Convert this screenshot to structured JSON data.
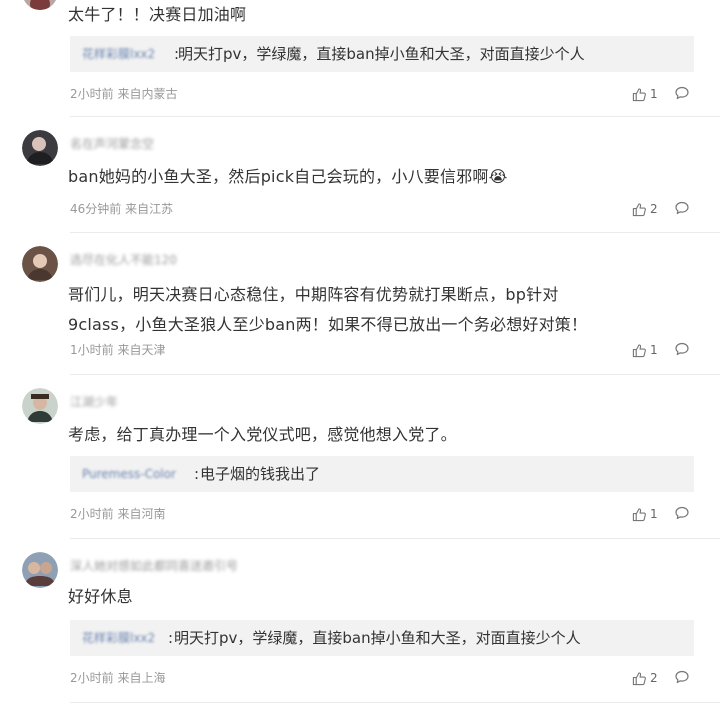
{
  "comments": [
    {
      "username": "",
      "text": "太牛了！！决赛日加油啊",
      "reply": {
        "user": "花样彩膜lxx2",
        "colon": ":",
        "text": "明天打pv，学绿魔，直接ban掉小鱼和大圣，对面直接少个人"
      },
      "meta": "2小时前 来自内蒙古",
      "likes": "1"
    },
    {
      "username": "名在声河蒙念空",
      "text": "ban她妈的小鱼大圣，然后pick自己会玩的，小八要信邪啊😭",
      "meta": "46分钟前 来自江苏",
      "likes": "2"
    },
    {
      "username": "选尽在化人不能120",
      "text_lines": [
        "哥们儿，明天决赛日心态稳住，中期阵容有优势就打果断点，bp针对",
        "9class，小鱼大圣狼人至少ban两！如果不得已放出一个务必想好对策！"
      ],
      "meta": "1小时前 来自天津",
      "likes": "1"
    },
    {
      "username": "江湖少年",
      "text": "考虑，给丁真办理一个入党仪式吧，感觉他想入党了。",
      "reply": {
        "user": "Puremess-Color",
        "colon": ":",
        "text": "电子烟的钱我出了"
      },
      "meta": "2小时前 来自河南",
      "likes": "1"
    },
    {
      "username": "深人她对感如此都同喜送邀引号",
      "text": "好好休息",
      "reply": {
        "user": "花样彩膜lxx2",
        "colon": ":",
        "text": "明天打pv，学绿魔，直接ban掉小鱼和大圣，对面直接少个人"
      },
      "meta": "2小时前 来自上海",
      "likes": "2"
    }
  ],
  "icons": {
    "like": "thumbs-up-icon",
    "reply": "speech-bubble-icon"
  },
  "colors": {
    "text": "#333333",
    "meta": "#999999",
    "reply_bg": "#f2f2f2",
    "reply_user": "#6a84b0",
    "divider": "#ebebeb"
  }
}
